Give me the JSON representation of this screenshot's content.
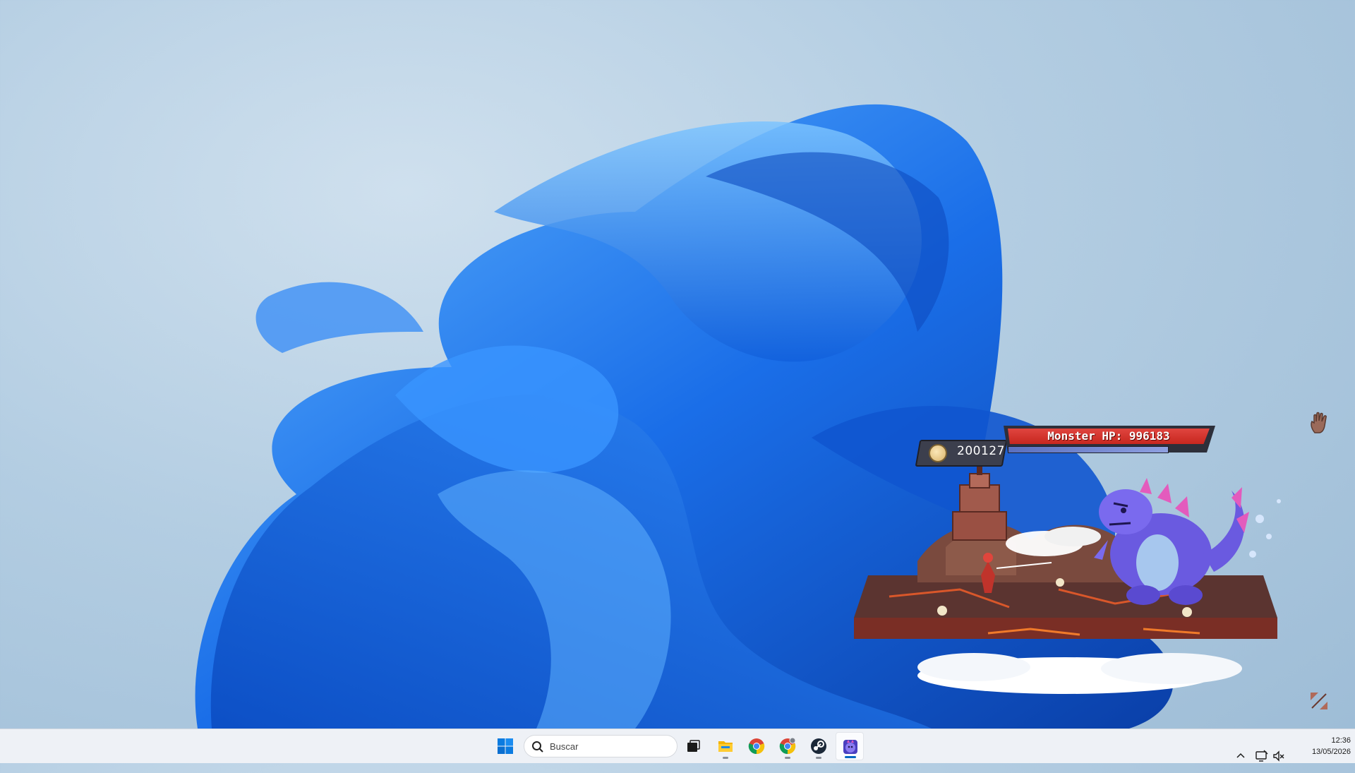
{
  "game": {
    "coins": "200127",
    "monster_hp_label": "Monster HP: 996183",
    "monster_hp_fraction": 0.92
  },
  "taskbar": {
    "search_placeholder": "Buscar",
    "apps": [
      {
        "name": "start-button",
        "icon": "windows-logo-icon"
      },
      {
        "name": "task-view-button",
        "icon": "task-view-icon"
      },
      {
        "name": "file-explorer-button",
        "icon": "folder-icon",
        "running": true
      },
      {
        "name": "chrome-button",
        "icon": "chrome-icon"
      },
      {
        "name": "chrome-profile-button",
        "icon": "chrome-profile-icon",
        "running": true
      },
      {
        "name": "steam-button",
        "icon": "steam-icon",
        "running": true
      },
      {
        "name": "game-button",
        "icon": "monster-game-icon",
        "running": true,
        "active": true
      }
    ],
    "clock": {
      "time": "12:36",
      "date": "13/05/2026"
    }
  },
  "colors": {
    "bloom_blue": "#1a6ee8",
    "hp_red": "#d1312a",
    "taskbar_bg": "#eef1f6",
    "accent": "#0067c0"
  }
}
